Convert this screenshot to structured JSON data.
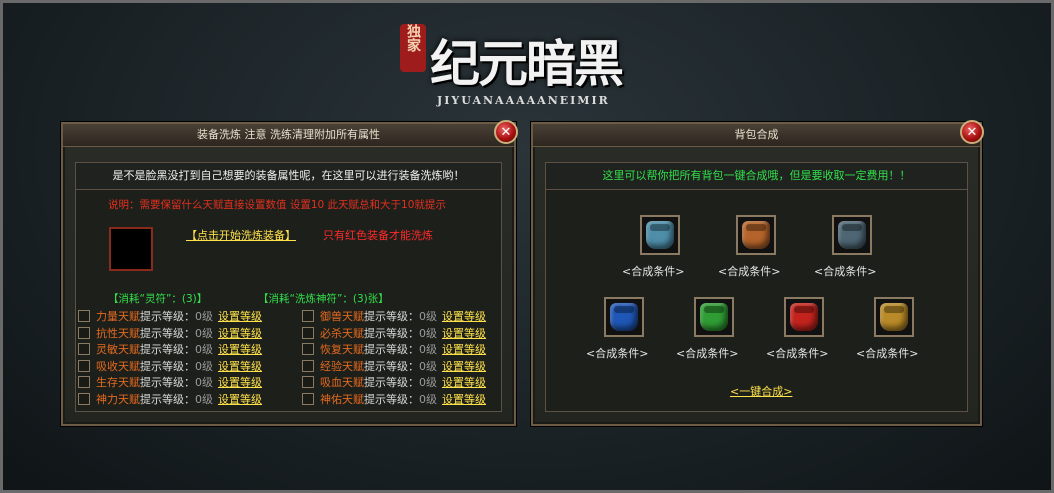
{
  "logo": {
    "badge": "独家",
    "title": "纪元暗黑",
    "subtitle": "JIYUANAAAAANEIMIR"
  },
  "left_panel": {
    "title": "装备洗炼 注意 洗练清理附加所有属性",
    "close": "✕",
    "notice": "是不是脸黑没打到自己想要的装备属性呢，在这里可以进行装备洗炼哟！",
    "desc": "说明：需要保留什么天赋直接设置数值 设置10 此天赋总和大于10就提示",
    "start_link": "【点击开始洗炼装备】",
    "red_note": "只有红色装备才能洗炼",
    "cost_left": "【消耗“灵符”：(3)】",
    "cost_right": "【消耗“洗炼神符”：(3)张】",
    "text_suffix": "提示等级：",
    "level_value": "0级",
    "set_label": "设置等级",
    "talents_left": [
      "力量天赋",
      "抗性天赋",
      "灵敏天赋",
      "吸收天赋",
      "生存天赋",
      "神力天赋"
    ],
    "talents_right": [
      "御兽天赋",
      "必杀天赋",
      "恢复天赋",
      "经验天赋",
      "吸血天赋",
      "神佑天赋"
    ]
  },
  "right_panel": {
    "title": "背包合成",
    "close": "✕",
    "notice": "这里可以帮你把所有背包一键合成哦，但是要收取一定费用！！",
    "condition_label": "<合成条件>",
    "merge_all": "<一键合成>",
    "bags_row1": [
      {
        "name": "bag-light-blue",
        "color": "#4e8ea8"
      },
      {
        "name": "bag-orange",
        "color": "#b4642a"
      },
      {
        "name": "bag-steel",
        "color": "#4e6674"
      }
    ],
    "bags_row2": [
      {
        "name": "bag-blue",
        "color": "#1f57b6"
      },
      {
        "name": "bag-green",
        "color": "#2f9d34"
      },
      {
        "name": "bag-red",
        "color": "#c4231d"
      },
      {
        "name": "bag-gold",
        "color": "#b98a27"
      }
    ]
  }
}
